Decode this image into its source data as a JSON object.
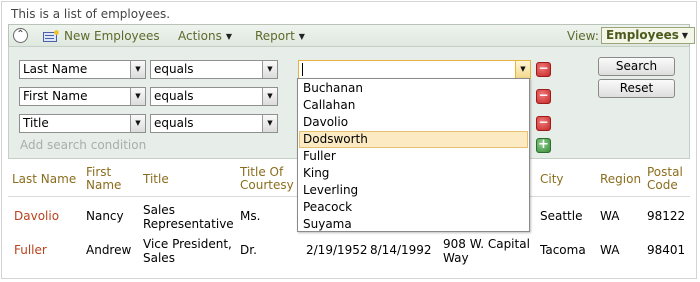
{
  "description": "This is a list of employees.",
  "toolbar": {
    "new_label": "New Employees",
    "actions_label": "Actions",
    "report_label": "Report",
    "view_label": "View:",
    "view_value": "Employees"
  },
  "search": {
    "conditions": [
      {
        "field": "Last Name",
        "operator": "equals",
        "value": ""
      },
      {
        "field": "First Name",
        "operator": "equals",
        "value": ""
      },
      {
        "field": "Title",
        "operator": "equals",
        "value": ""
      }
    ],
    "add_label": "Add search condition",
    "search_button": "Search",
    "reset_button": "Reset"
  },
  "autocomplete": {
    "items": [
      "Buchanan",
      "Callahan",
      "Davolio",
      "Dodsworth",
      "Fuller",
      "King",
      "Leverling",
      "Peacock",
      "Suyama"
    ],
    "highlighted": "Dodsworth"
  },
  "grid": {
    "headers": {
      "last_name": "Last Name",
      "first_name": "First Name",
      "title": "Title",
      "title_of_courtesy": "Title Of Courtesy",
      "city": "City",
      "region": "Region",
      "postal_code": "Postal Code"
    },
    "rows": [
      {
        "last_name": "Davolio",
        "first_name": "Nancy",
        "title": "Sales Representative",
        "courtesy": "Ms.",
        "birth_date": "",
        "hire_date": "",
        "address": "",
        "city": "Seattle",
        "region": "WA",
        "postal_code": "98122"
      },
      {
        "last_name": "Fuller",
        "first_name": "Andrew",
        "title": "Vice President, Sales",
        "courtesy": "Dr.",
        "birth_date": "2/19/1952",
        "hire_date": "8/14/1992",
        "address": "908 W. Capital Way",
        "city": "Tacoma",
        "region": "WA",
        "postal_code": "98401"
      }
    ]
  },
  "colors": {
    "accent_text": "#5c6a2a",
    "header_text": "#8a6d1d",
    "link_text": "#b8421c",
    "panel_bg": "#e7ede9",
    "highlight_bg": "#fcebc2"
  }
}
